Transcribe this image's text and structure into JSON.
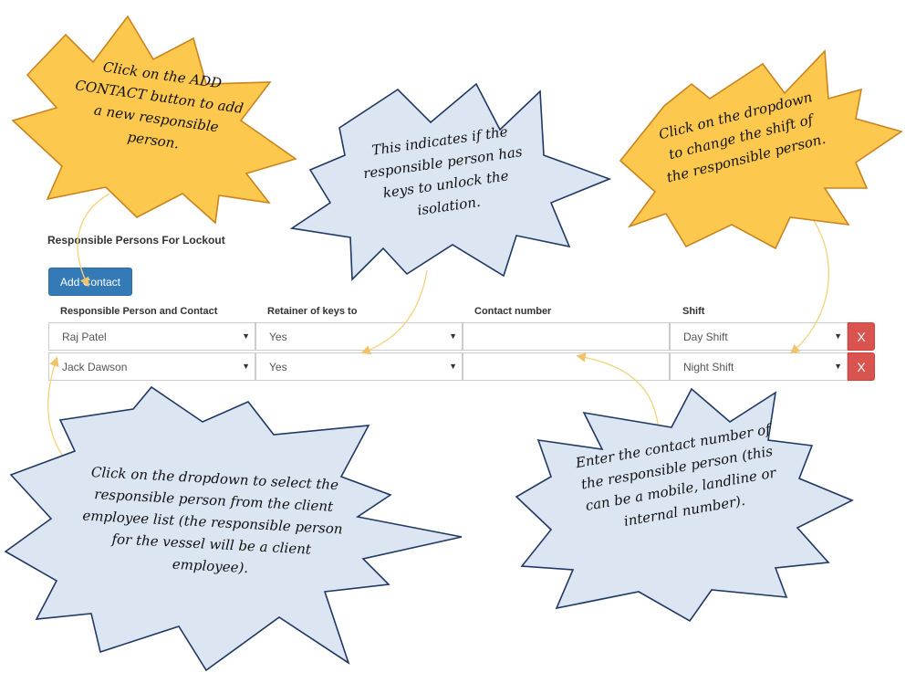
{
  "section": {
    "title": "Responsible Persons For Lockout"
  },
  "add_button": {
    "label": "Add Contact"
  },
  "columns": [
    "Responsible Person and Contact",
    "Retainer of keys to",
    "Contact number",
    "Shift"
  ],
  "rows": [
    {
      "person": "Raj Patel",
      "keys": "Yes",
      "contact": "",
      "shift": "Day Shift",
      "delete": "X"
    },
    {
      "person": "Jack Dawson",
      "keys": "Yes",
      "contact": "",
      "shift": "Night Shift",
      "delete": "X"
    }
  ],
  "icons": {
    "dropdown": "caret-down-icon"
  },
  "callouts": {
    "add_contact": "Click on the ADD CONTACT button to add a new responsible person.",
    "keys": "This indicates if the responsible person has keys to unlock the isolation.",
    "shift": "Click on the dropdown to change the shift of the responsible person.",
    "person": "Click on the dropdown to select the responsible person from the client employee list (the responsible person for the vessel will be a client employee).",
    "contact": "Enter the contact number of the responsible person (this can be a mobile, landline or internal number)."
  },
  "colors": {
    "primary": "#337ab7",
    "danger": "#d9534f",
    "burst_yellow": "#fcc94e",
    "burst_blue": "#dce6f2"
  }
}
